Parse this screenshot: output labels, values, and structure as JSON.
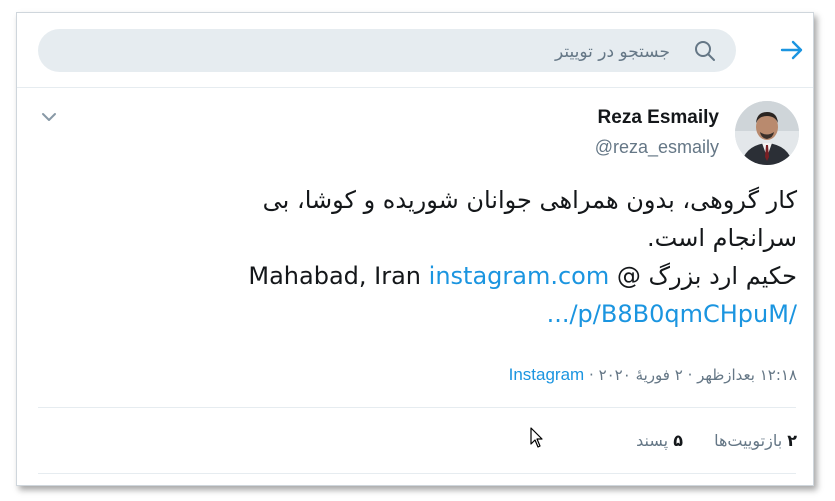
{
  "search": {
    "placeholder": "جستجو در توییتر"
  },
  "icons": {
    "back": "arrow-right-icon",
    "search": "search-icon",
    "caret": "chevron-down-icon"
  },
  "colors": {
    "accent": "#1b95e0",
    "search_bg": "#e6ecf0",
    "text_primary": "#14171a",
    "text_secondary": "#657786"
  },
  "tweet": {
    "display_name": "Reza Esmaily",
    "handle": "@reza_esmaily",
    "text_line1": "کار گروهی، بدون همراهی جوانان شوریده و کوشا، بی",
    "text_line2": "سرانجام است.",
    "text_line3_prefix": "حکیم ارد بزرگ @ ",
    "location": "Mahabad, Iran",
    "link_line1": "instagram.com",
    "link_line2": "/p/B8B0qmCHpuM/...",
    "time": "۱۲:۱۸ بعدازظهر",
    "date": "۲ فوریهٔ ۲۰۲۰",
    "separator": "·",
    "source": "Instagram",
    "retweets_count": "۲",
    "retweets_label": "بازتوییت‌ها",
    "likes_count": "۵",
    "likes_label": "پسند"
  }
}
